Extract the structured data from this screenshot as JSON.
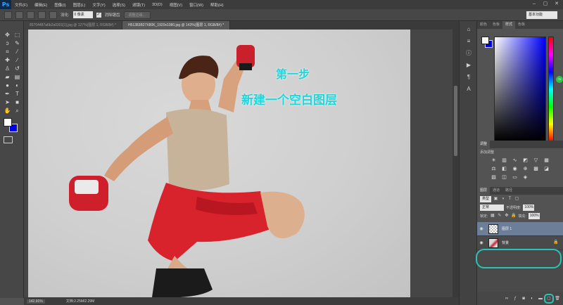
{
  "app": {
    "logo": "Ps"
  },
  "menu": [
    "文件(F)",
    "编辑(E)",
    "图像(I)",
    "图层(L)",
    "文字(Y)",
    "选择(S)",
    "滤镜(T)",
    "3D(D)",
    "视图(V)",
    "窗口(W)",
    "帮助(H)"
  ],
  "window_controls": [
    "–",
    "▢",
    "✕"
  ],
  "options": {
    "feather_label": "羽化:",
    "feather_value": "0 像素",
    "antialias_label": "消除锯齿",
    "refine_button": "调整边缘...",
    "workspace": "基本功能"
  },
  "tabs": [
    {
      "label": "85704487a6b2a0301[1].jpg @ 127%(图层 1, RGB/8#) *"
    },
    {
      "label": "H51383B27X80K_1920x1080.jpg @ 143%(图层 1, RGB/8#) *"
    }
  ],
  "annotations": {
    "line1": "第一步",
    "line2": "新建一个空白图层"
  },
  "status": {
    "zoom": "142.91%",
    "doc": "文档:2.25M/2.29M"
  },
  "color_panel": {
    "tabs": [
      "颜色",
      "色板",
      "样式",
      "色板"
    ],
    "fg_color": "#ffffff",
    "bg_color": "#0000e6",
    "knob_label": "70"
  },
  "adjustments": {
    "title_tab": "调整",
    "add_label": "添加调整"
  },
  "layers_panel": {
    "tabs": [
      "图层",
      "通道",
      "路径"
    ],
    "filter_label": "类型",
    "blend_mode": "正常",
    "opacity_label": "不透明度:",
    "opacity_value": "100%",
    "lock_label": "锁定:",
    "fill_label": "填充:",
    "fill_value": "100%",
    "layers": [
      {
        "name": "图层 1",
        "selected": true
      },
      {
        "name": "背景",
        "selected": false
      }
    ]
  }
}
